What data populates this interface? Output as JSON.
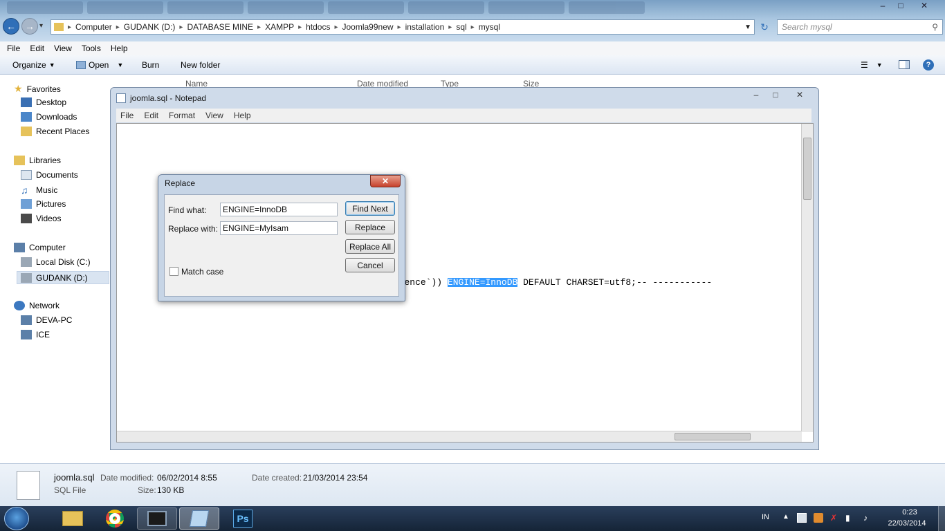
{
  "explorer": {
    "breadcrumb": [
      "Computer",
      "GUDANK (D:)",
      "DATABASE MINE",
      "XAMPP",
      "htdocs",
      "Joomla99new",
      "installation",
      "sql",
      "mysql"
    ],
    "search_placeholder": "Search mysql",
    "menu": [
      "File",
      "Edit",
      "View",
      "Tools",
      "Help"
    ],
    "toolbar": {
      "organize": "Organize",
      "open": "Open",
      "burn": "Burn",
      "new_folder": "New folder"
    },
    "columns": {
      "name": "Name",
      "date_modified": "Date modified",
      "type": "Type",
      "size": "Size"
    }
  },
  "nav": {
    "favorites": "Favorites",
    "desktop": "Desktop",
    "downloads": "Downloads",
    "recent": "Recent Places",
    "libraries": "Libraries",
    "documents": "Documents",
    "music": "Music",
    "pictures": "Pictures",
    "videos": "Videos",
    "computer": "Computer",
    "local_disk": "Local Disk (C:)",
    "gudank": "GUDANK (D:)",
    "network": "Network",
    "deva_pc": "DEVA-PC",
    "ice": "ICE"
  },
  "details": {
    "filename": "joomla.sql",
    "modified_label": "Date modified:",
    "modified_value": "06/02/2014 8:55",
    "created_label": "Date created:",
    "created_value": "21/03/2014 23:54",
    "type": "SQL File",
    "size_label": "Size:",
    "size_value": "130 KB"
  },
  "notepad": {
    "title": "joomla.sql - Notepad",
    "menu": [
      "File",
      "Edit",
      "Format",
      "View",
      "Help"
    ],
    "highlight": "ENGINE=InnoDB"
  },
  "replace": {
    "title": "Replace",
    "find_label": "Find what:",
    "find_value": "ENGINE=InnoDB",
    "replace_label": "Replace with:",
    "replace_value": "ENGINE=MyIsam",
    "match_case": "Match case",
    "find_next": "Find Next",
    "replace_btn": "Replace",
    "replace_all": "Replace All",
    "cancel": "Cancel"
  },
  "taskbar": {
    "lang": "IN",
    "time": "0:23",
    "date": "22/03/2014"
  },
  "colors": {
    "accent": "#3399ff",
    "taskbar": "#1d2f47"
  }
}
